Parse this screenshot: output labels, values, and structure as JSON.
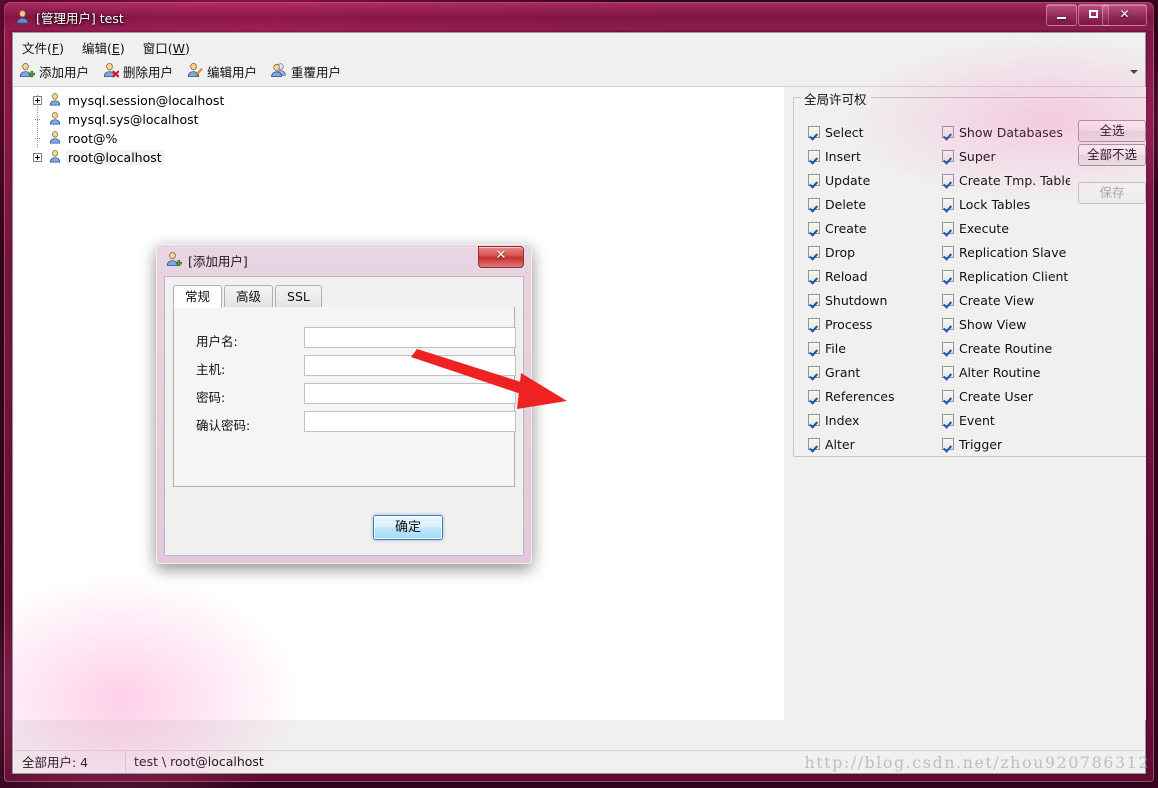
{
  "window": {
    "title": "[管理用户] test",
    "icon": "user-icon",
    "minimize_label": "最小化",
    "maximize_label": "最大化",
    "close_label": "✕"
  },
  "menubar": {
    "items": [
      {
        "name": "file",
        "text": "文件",
        "accel": "F"
      },
      {
        "name": "edit",
        "text": "编辑",
        "accel": "E"
      },
      {
        "name": "window",
        "text": "窗口",
        "accel": "W"
      }
    ]
  },
  "toolbar": {
    "items": [
      {
        "name": "add-user",
        "label": "添加用户",
        "icon": "user-add-icon"
      },
      {
        "name": "delete-user",
        "label": "删除用户",
        "icon": "user-delete-icon"
      },
      {
        "name": "edit-user",
        "label": "编辑用户",
        "icon": "user-edit-icon"
      },
      {
        "name": "duplicate-user",
        "label": "重覆用户",
        "icon": "user-duplicate-icon"
      }
    ],
    "overflow_icon": "chevron-down-icon"
  },
  "tree": {
    "nodes": [
      {
        "label": "mysql.session@localhost",
        "expandable": true,
        "selected": false
      },
      {
        "label": "mysql.sys@localhost",
        "expandable": false,
        "selected": false
      },
      {
        "label": "root@%",
        "expandable": false,
        "selected": false
      },
      {
        "label": "root@localhost",
        "expandable": true,
        "selected": true
      }
    ]
  },
  "permissions": {
    "legend": "全局许可权",
    "column1": [
      {
        "label": "Select",
        "checked": true
      },
      {
        "label": "Insert",
        "checked": true
      },
      {
        "label": "Update",
        "checked": true
      },
      {
        "label": "Delete",
        "checked": true
      },
      {
        "label": "Create",
        "checked": true
      },
      {
        "label": "Drop",
        "checked": true
      },
      {
        "label": "Reload",
        "checked": true
      },
      {
        "label": "Shutdown",
        "checked": true
      },
      {
        "label": "Process",
        "checked": true
      },
      {
        "label": "File",
        "checked": true
      },
      {
        "label": "Grant",
        "checked": true
      },
      {
        "label": "References",
        "checked": true
      },
      {
        "label": "Index",
        "checked": true
      },
      {
        "label": "Alter",
        "checked": true
      }
    ],
    "column2": [
      {
        "label": "Show Databases",
        "checked": true
      },
      {
        "label": "Super",
        "checked": true
      },
      {
        "label": "Create Tmp. Table",
        "checked": true
      },
      {
        "label": "Lock Tables",
        "checked": true
      },
      {
        "label": "Execute",
        "checked": true
      },
      {
        "label": "Replication Slave",
        "checked": true
      },
      {
        "label": "Replication Client",
        "checked": true
      },
      {
        "label": "Create View",
        "checked": true
      },
      {
        "label": "Show View",
        "checked": true
      },
      {
        "label": "Create Routine",
        "checked": true
      },
      {
        "label": "Alter Routine",
        "checked": true
      },
      {
        "label": "Create User",
        "checked": true
      },
      {
        "label": "Event",
        "checked": true
      },
      {
        "label": "Trigger",
        "checked": true
      }
    ],
    "buttons": {
      "select_all": "全选",
      "deselect_all": "全部不选",
      "save": "保存",
      "save_disabled": true
    }
  },
  "statusbar": {
    "user_count": "全部用户: 4",
    "path": "test \\ root@localhost"
  },
  "watermark": "http://blog.csdn.net/zhou920786312",
  "dialog": {
    "title": "[添加用户]",
    "icon": "user-add-icon",
    "close_label": "✕",
    "tabs": [
      {
        "label": "常规",
        "active": true
      },
      {
        "label": "高级",
        "active": false
      },
      {
        "label": "SSL",
        "active": false
      }
    ],
    "fields": [
      {
        "name": "username",
        "label": "用户名:",
        "value": "",
        "placeholder": ""
      },
      {
        "name": "host",
        "label": "主机:",
        "value": "",
        "placeholder": ""
      },
      {
        "name": "password",
        "label": "密码:",
        "value": "",
        "placeholder": ""
      },
      {
        "name": "confirm-password",
        "label": "确认密码:",
        "value": "",
        "placeholder": ""
      }
    ],
    "ok_label": "确定"
  },
  "colors": {
    "accent": "#c31b6a",
    "checkbox_check": "#1b52b0",
    "annotation_arrow": "#ee2222",
    "dialog_close": "#c62f2f"
  }
}
